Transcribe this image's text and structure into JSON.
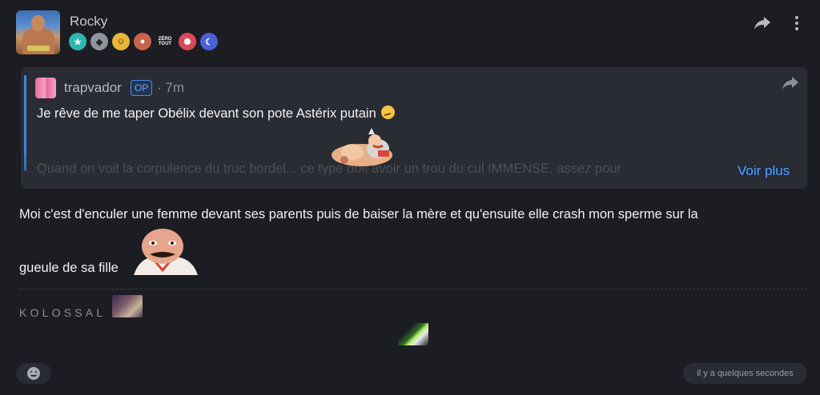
{
  "post": {
    "author": "Rocky",
    "badges": [
      {
        "icon": "moderator-star-icon",
        "color": "#2bb7b0"
      },
      {
        "icon": "silver-shield-icon",
        "color": "#8f949c"
      },
      {
        "icon": "gold-smiley-badge-icon",
        "color": "#e8b637"
      },
      {
        "icon": "character-face-badge-icon",
        "color": "#c9634b"
      },
      {
        "icon": "zero-tout-badge-icon",
        "label_top": "ZÉRO",
        "label_bottom": "TOUT"
      },
      {
        "icon": "pink-cake-badge-icon",
        "color": "#d84a5a"
      },
      {
        "icon": "moon-orb-badge-icon",
        "color": "#4b5fd6"
      }
    ],
    "quote": {
      "author": "trapvador",
      "op_label": "OP",
      "time": "· 7m",
      "line1": "Je rêve de me taper Obélix devant son pote Astérix putain",
      "line2": "Quand on voit la corpulence du truc bordel...              ce type doit avoir un trou du cul IMMENSE, assez pour",
      "more_label": "Voir plus"
    },
    "body": {
      "line1": "Moi c'est d'enculer une femme devant ses parents puis de baiser la mère et qu'ensuite elle crash mon sperme sur la",
      "line2": "gueule de sa fille"
    },
    "signature": {
      "text": "KOLOSSAL"
    },
    "footer": {
      "timestamp": "il y a quelques secondes"
    }
  },
  "colors": {
    "background": "#1c1d22",
    "quote_background": "#2a2c33",
    "accent": "#3d86e6",
    "link": "#5aa3ff"
  }
}
